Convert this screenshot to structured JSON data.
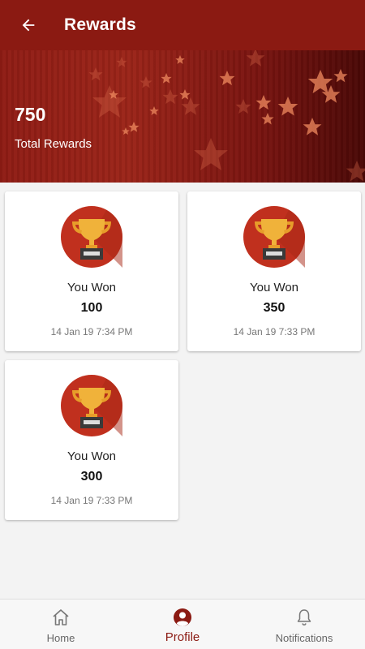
{
  "appbar": {
    "title": "Rewards"
  },
  "banner": {
    "total": "750",
    "total_label": "Total Rewards"
  },
  "rewards": [
    {
      "won_label": "You Won",
      "amount": "100",
      "date": "14 Jan 19 7:34 PM"
    },
    {
      "won_label": "You Won",
      "amount": "350",
      "date": "14 Jan 19 7:33 PM"
    },
    {
      "won_label": "You Won",
      "amount": "300",
      "date": "14 Jan 19 7:33 PM"
    }
  ],
  "bottom_nav": [
    {
      "label": "Home",
      "icon": "home-icon",
      "active": false
    },
    {
      "label": "Profile",
      "icon": "profile-icon",
      "active": true
    },
    {
      "label": "Notifications",
      "icon": "bell-icon",
      "active": false
    }
  ],
  "colors": {
    "primary": "#8b1a12",
    "trophy_circle": "#c0301e",
    "trophy_gold": "#f0b23a"
  }
}
